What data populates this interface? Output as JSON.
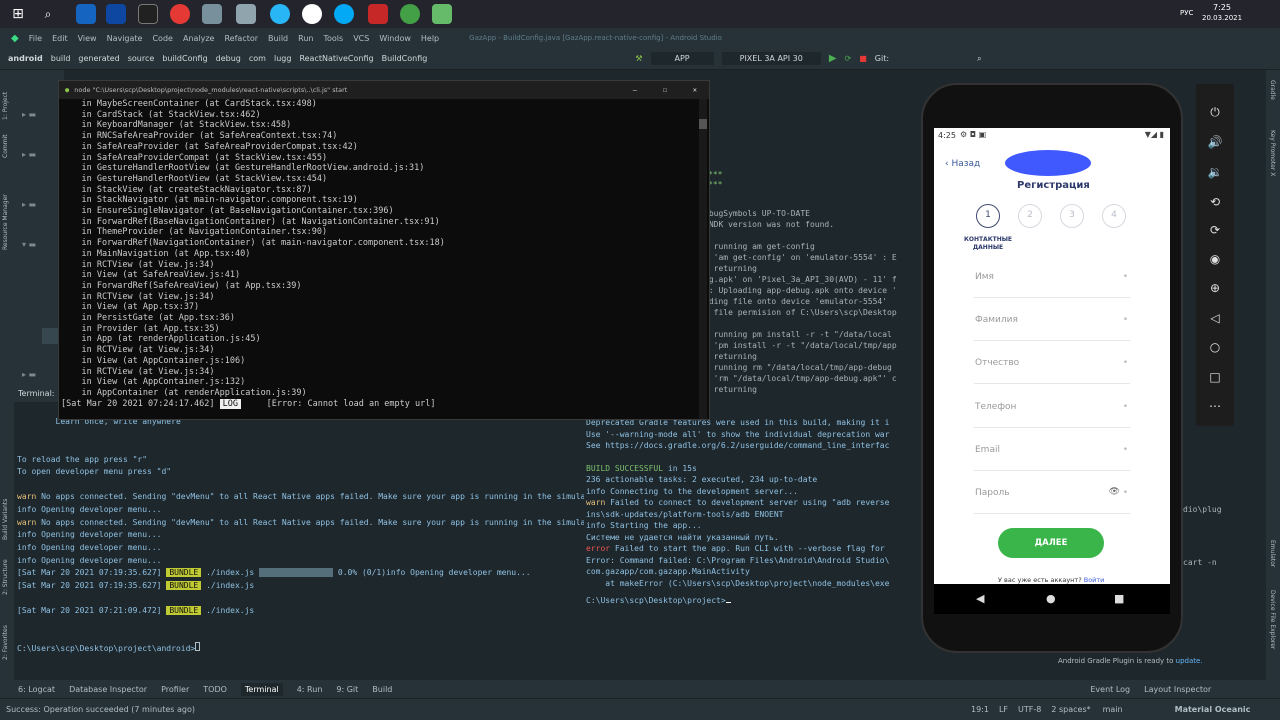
{
  "taskbar": {
    "time": "7:25",
    "date": "20.03.2021",
    "lang": "РУС"
  },
  "menu": [
    "File",
    "Edit",
    "View",
    "Navigate",
    "Code",
    "Analyze",
    "Refactor",
    "Build",
    "Run",
    "Tools",
    "VCS",
    "Window",
    "Help"
  ],
  "window_title": "GazApp - BuildConfig.java [GazApp.react-native-config] - Android Studio",
  "breadcrumbs": [
    "android",
    "build",
    "generated",
    "source",
    "buildConfig",
    "debug",
    "com",
    "lugg",
    "ReactNativeConfig",
    "BuildConfig"
  ],
  "run_config": {
    "app": "APP",
    "device": "PIXEL 3A API 30",
    "git": "Git:"
  },
  "node_window": {
    "title": "node \"C:\\Users\\scp\\Desktop\\project\\node_modules\\react-native\\scripts\\..\\cli.js\" start",
    "lines": [
      "    in MaybeScreenContainer (at CardStack.tsx:498)",
      "    in CardStack (at StackView.tsx:462)",
      "    in KeyboardManager (at StackView.tsx:458)",
      "    in RNCSafeAreaProvider (at SafeAreaContext.tsx:74)",
      "    in SafeAreaProvider (at SafeAreaProviderCompat.tsx:42)",
      "    in SafeAreaProviderCompat (at StackView.tsx:455)",
      "    in GestureHandlerRootView (at GestureHandlerRootView.android.js:31)",
      "    in GestureHandlerRootView (at StackView.tsx:454)",
      "    in StackView (at createStackNavigator.tsx:87)",
      "    in StackNavigator (at main-navigator.component.tsx:19)",
      "    in EnsureSingleNavigator (at BaseNavigationContainer.tsx:396)",
      "    in ForwardRef(BaseNavigationContainer) (at NavigationContainer.tsx:91)",
      "    in ThemeProvider (at NavigationContainer.tsx:90)",
      "    in ForwardRef(NavigationContainer) (at main-navigator.component.tsx:18)",
      "    in MainNavigation (at App.tsx:40)",
      "    in RCTView (at View.js:34)",
      "    in View (at SafeAreaView.js:41)",
      "    in ForwardRef(SafeAreaView) (at App.tsx:39)",
      "    in RCTView (at View.js:34)",
      "    in View (at App.tsx:37)",
      "    in PersistGate (at App.tsx:36)",
      "    in Provider (at App.tsx:35)",
      "    in App (at renderApplication.js:45)",
      "    in RCTView (at View.js:34)",
      "    in View (at AppContainer.js:106)",
      "    in RCTView (at View.js:34)",
      "    in View (at AppContainer.js:132)",
      "    in AppContainer (at renderApplication.js:39)"
    ],
    "last_time": "[Sat Mar 20 2021 07:24:17.462]",
    "last_badge": "LOG",
    "last_msg": "     [Error: Cannot load an empty url]"
  },
  "terminal_label": "Terminal:",
  "terminal1": {
    "slogan": "        Learn once, write anywhere",
    "reload": "To reload the app press \"r\"",
    "devmenu": "To open developer menu press \"d\"",
    "warn1": " No apps connected. Sending \"devMenu\" to all React Native apps failed. Make sure your app is running in the simulator",
    "info1": "info Opening developer menu...",
    "warn2": " No apps connected. Sending \"devMenu\" to all React Native apps failed. Make sure your app is running in the simulator",
    "info2": "info Opening developer menu...",
    "info3": "info Opening developer menu...",
    "info4": "info Opening developer menu...",
    "b1_time": "[Sat Mar 20 2021 07:19:35.627]",
    "b1_badge": "BUNDLE",
    "b1_file": "./index.js",
    "b1_progress": "0.0% (0/1)info Opening developer menu...",
    "b2_time": "[Sat Mar 20 2021 07:19:35.627]",
    "b2_badge": "BUNDLE",
    "b2_file": "./index.js",
    "b3_time": "[Sat Mar 20 2021 07:21:09.472]",
    "b3_badge": "BUNDLE",
    "b3_file": "./index.js",
    "prompt": "C:\\Users\\scp\\Desktop\\project\\android>"
  },
  "terminal2": {
    "stars1": "***",
    "stars2": "***",
    "l1": "ebugSymbols UP-TO-DATE",
    "l2": " NDK version was not found.",
    "l3": "g",
    "l4": ": running am get-config",
    "l5": ": 'am get-config' on 'emulator-5554' : E",
    "l6": ": returning",
    "l7": "ug.apk' on 'Pixel_3a_API_30(AVD) - 11' f",
    "l8": "k: Uploading app-debug.apk onto device '",
    "l9": "ading file onto device 'emulator-5554'",
    "l10": "g file permision of C:\\Users\\scp\\Desktop",
    "l11": ": running pm install -r -t \"/data/local",
    "l12": ": 'pm install -r -t \"/data/local/tmp/app",
    "l13": ": returning",
    "l14": ": running rm \"/data/local/tmp/app-debug",
    "l15": ": 'rm \"/data/local/tmp/app-debug.apk\"' c",
    "l16": ": returning",
    "d1": "Deprecated Gradle features were used in this build, making it i",
    "d2": "Use '--warning-mode all' to show the individual deprecation war",
    "d3": "See https://docs.gradle.org/6.2/userguide/command_line_interfac",
    "build": "BUILD SUCCESSFUL",
    "build_time": " in 15s",
    "tasks": "236 actionable tasks: 2 executed, 234 up-to-date",
    "conn": "info Connecting to the development server...",
    "warn": " Failed to connect to development server using \"adb reverse",
    "sdk": "ins\\sdk-updates/platform-tools/adb ENOENT",
    "starting": "info Starting the app...",
    "ru": "Системе не удается найти указанный путь.",
    "error": " Failed to start the app. Run CLI with --verbose flag for",
    "err2": "Error: Command failed: C:\\Program Files\\Android\\Android Studio\\",
    "err3": "com.gazapp/com.gazapp.MainActivity",
    "err4": "    at makeError (C:\\Users\\scp\\Desktop\\project\\node_modules\\exe",
    "prompt": "C:\\Users\\scp\\Desktop\\project>",
    "side1": "dio\\plug",
    "side2": "cart -n",
    "plugin_msg": "Android Gradle Plugin is ready to ",
    "plugin_link": "update."
  },
  "phone": {
    "time": "4:25",
    "back": "‹ Назад",
    "title": "Регистрация",
    "steps": [
      "1",
      "2",
      "3",
      "4"
    ],
    "step_label": "КОНТАКТНЫЕ ДАННЫЕ",
    "fields": [
      "Имя",
      "Фамилия",
      "Отчество",
      "Телефон",
      "Email",
      "Пароль"
    ],
    "button": "ДАЛЕЕ",
    "account_q": "У вас уже есть аккаунт?",
    "login": "Войти"
  },
  "bottom_tabs": [
    "6: Logcat",
    "Database Inspector",
    "Profiler",
    "TODO",
    "Terminal",
    "4: Run",
    "9: Git",
    "Build"
  ],
  "bottom_right": [
    "Event Log",
    "Layout Inspector"
  ],
  "status": {
    "message": "Success: Operation succeeded (7 minutes ago)",
    "pos": "19:1",
    "lf": "LF",
    "enc": "UTF-8",
    "indent": "2 spaces*",
    "branch": "main",
    "theme": "Material Oceanic"
  },
  "side_left": [
    "1: Project",
    "Commit",
    "Resource Manager",
    "Build Variants",
    "2: Structure",
    "2: Favorites"
  ],
  "side_right": [
    "Gradle",
    "Key Promoter X",
    "Emulator",
    "Device File Explorer"
  ]
}
